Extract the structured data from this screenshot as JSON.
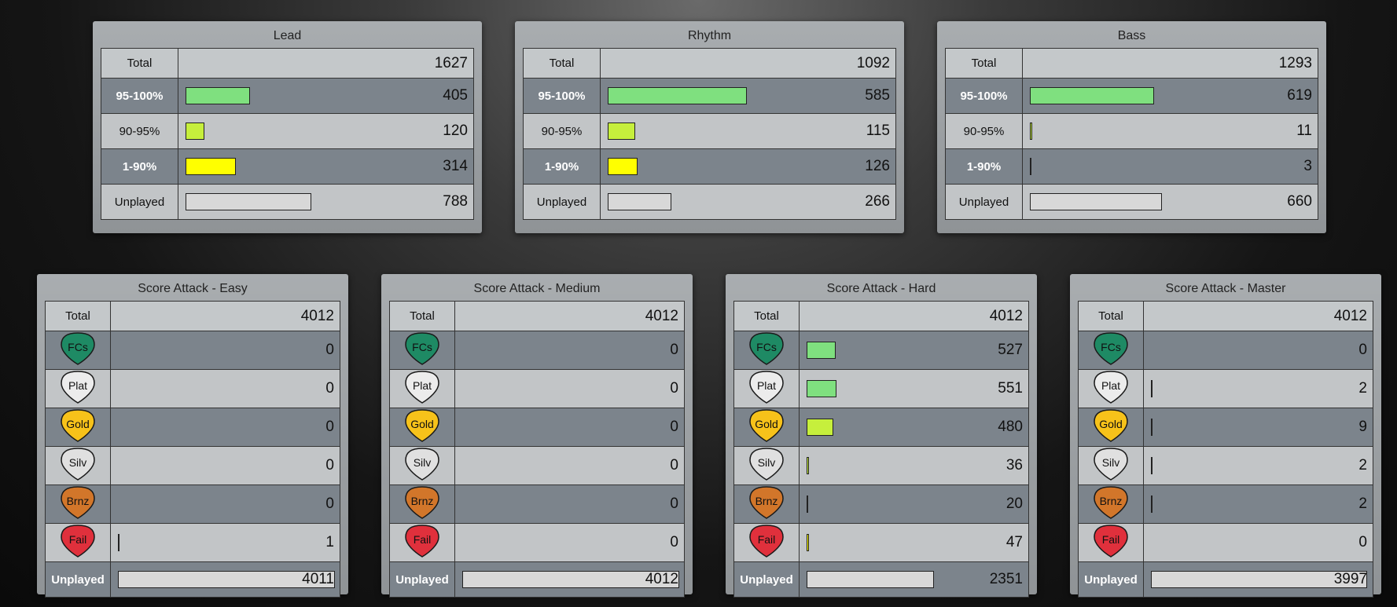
{
  "colors": {
    "bar_95": "#7fe07f",
    "bar_90": "#c6ef3c",
    "bar_1": "#ffff00",
    "bar_unplayed": "#d8d8d8",
    "fc": "#1e8a64",
    "plat": "#ececec",
    "gold": "#f7c21a",
    "silv": "#e0e0e0",
    "brnz": "#d2762a",
    "fail": "#e0303c"
  },
  "instruments": [
    {
      "title": "Lead",
      "total_label": "Total",
      "total": "1627",
      "rows": [
        {
          "label": "95-100%",
          "value": "405",
          "frac": 0.249,
          "color": "bar_95"
        },
        {
          "label": "90-95%",
          "value": "120",
          "frac": 0.074,
          "color": "bar_90"
        },
        {
          "label": "1-90%",
          "value": "314",
          "frac": 0.193,
          "color": "bar_1"
        },
        {
          "label": "Unplayed",
          "value": "788",
          "frac": 0.484,
          "color": "bar_unplayed"
        }
      ]
    },
    {
      "title": "Rhythm",
      "total_label": "Total",
      "total": "1092",
      "rows": [
        {
          "label": "95-100%",
          "value": "585",
          "frac": 0.536,
          "color": "bar_95"
        },
        {
          "label": "90-95%",
          "value": "115",
          "frac": 0.105,
          "color": "bar_90"
        },
        {
          "label": "1-90%",
          "value": "126",
          "frac": 0.115,
          "color": "bar_1"
        },
        {
          "label": "Unplayed",
          "value": "266",
          "frac": 0.244,
          "color": "bar_unplayed"
        }
      ]
    },
    {
      "title": "Bass",
      "total_label": "Total",
      "total": "1293",
      "rows": [
        {
          "label": "95-100%",
          "value": "619",
          "frac": 0.479,
          "color": "bar_95"
        },
        {
          "label": "90-95%",
          "value": "11",
          "frac": 0.009,
          "color": "bar_90"
        },
        {
          "label": "1-90%",
          "value": "3",
          "frac": 0.002,
          "color": "bar_1"
        },
        {
          "label": "Unplayed",
          "value": "660",
          "frac": 0.51,
          "color": "bar_unplayed"
        }
      ]
    }
  ],
  "score_attack": [
    {
      "title": "Score Attack - Easy",
      "total_label": "Total",
      "total": "4012",
      "rows": [
        {
          "pick": "FCs",
          "value": "0",
          "frac": 0,
          "bar": "bar_95"
        },
        {
          "pick": "Plat",
          "value": "0",
          "frac": 0,
          "bar": "bar_95"
        },
        {
          "pick": "Gold",
          "value": "0",
          "frac": 0,
          "bar": "bar_90"
        },
        {
          "pick": "Silv",
          "value": "0",
          "frac": 0,
          "bar": "bar_90"
        },
        {
          "pick": "Brnz",
          "value": "0",
          "frac": 0,
          "bar": "bar_1"
        },
        {
          "pick": "Fail",
          "value": "1",
          "frac": 0.001,
          "bar": "bar_1"
        }
      ],
      "unplayed_label": "Unplayed",
      "unplayed": "4011",
      "unplayed_frac": 1.0
    },
    {
      "title": "Score Attack - Medium",
      "total_label": "Total",
      "total": "4012",
      "rows": [
        {
          "pick": "FCs",
          "value": "0",
          "frac": 0,
          "bar": "bar_95"
        },
        {
          "pick": "Plat",
          "value": "0",
          "frac": 0,
          "bar": "bar_95"
        },
        {
          "pick": "Gold",
          "value": "0",
          "frac": 0,
          "bar": "bar_90"
        },
        {
          "pick": "Silv",
          "value": "0",
          "frac": 0,
          "bar": "bar_90"
        },
        {
          "pick": "Brnz",
          "value": "0",
          "frac": 0,
          "bar": "bar_1"
        },
        {
          "pick": "Fail",
          "value": "0",
          "frac": 0,
          "bar": "bar_1"
        }
      ],
      "unplayed_label": "Unplayed",
      "unplayed": "4012",
      "unplayed_frac": 1.0
    },
    {
      "title": "Score Attack - Hard",
      "total_label": "Total",
      "total": "4012",
      "rows": [
        {
          "pick": "FCs",
          "value": "527",
          "frac": 0.131,
          "bar": "bar_95"
        },
        {
          "pick": "Plat",
          "value": "551",
          "frac": 0.137,
          "bar": "bar_95"
        },
        {
          "pick": "Gold",
          "value": "480",
          "frac": 0.12,
          "bar": "bar_90"
        },
        {
          "pick": "Silv",
          "value": "36",
          "frac": 0.009,
          "bar": "bar_90"
        },
        {
          "pick": "Brnz",
          "value": "20",
          "frac": 0.005,
          "bar": "bar_1"
        },
        {
          "pick": "Fail",
          "value": "47",
          "frac": 0.012,
          "bar": "bar_1"
        }
      ],
      "unplayed_label": "Unplayed",
      "unplayed": "2351",
      "unplayed_frac": 0.586
    },
    {
      "title": "Score Attack - Master",
      "total_label": "Total",
      "total": "4012",
      "rows": [
        {
          "pick": "FCs",
          "value": "0",
          "frac": 0,
          "bar": "bar_95"
        },
        {
          "pick": "Plat",
          "value": "2",
          "frac": 0.0005,
          "bar": "bar_95"
        },
        {
          "pick": "Gold",
          "value": "9",
          "frac": 0.002,
          "bar": "bar_90"
        },
        {
          "pick": "Silv",
          "value": "2",
          "frac": 0.0005,
          "bar": "bar_90"
        },
        {
          "pick": "Brnz",
          "value": "2",
          "frac": 0.0005,
          "bar": "bar_1"
        },
        {
          "pick": "Fail",
          "value": "0",
          "frac": 0,
          "bar": "bar_1"
        }
      ],
      "unplayed_label": "Unplayed",
      "unplayed": "3997",
      "unplayed_frac": 0.996
    }
  ]
}
